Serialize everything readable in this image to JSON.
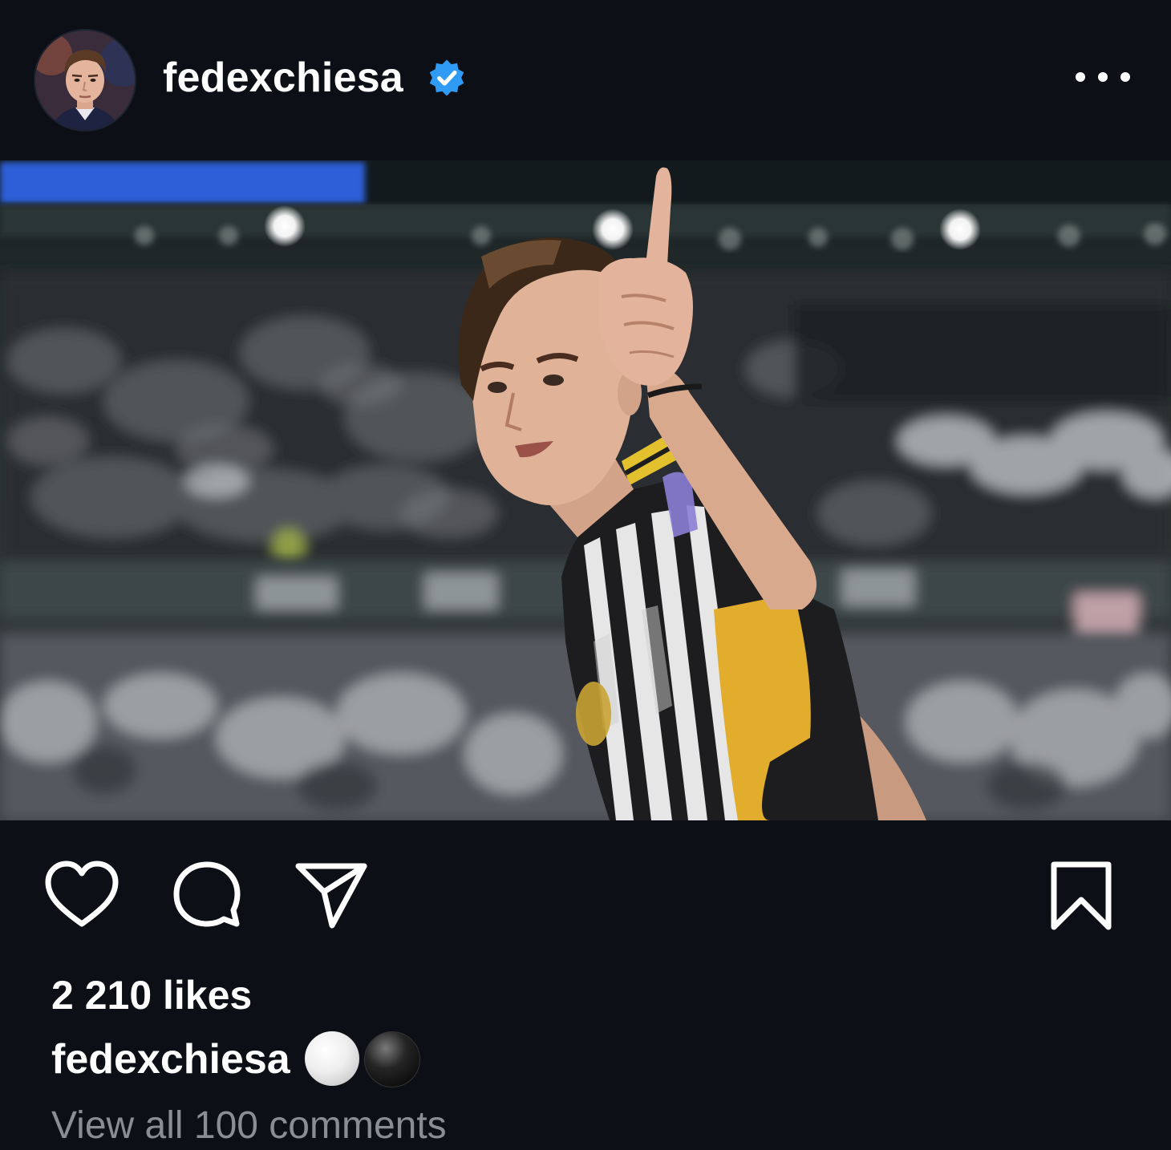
{
  "post": {
    "username": "fedexchiesa",
    "verified": true,
    "likes_text": "2 210 likes",
    "caption": {
      "username": "fedexchiesa",
      "text": "⚪⚫"
    },
    "view_comments_text": "View all 100 comments"
  },
  "icons": {
    "verified": "verified-badge-icon",
    "more": "more-options-icon",
    "like": "heart-icon",
    "comment": "comment-bubble-icon",
    "share": "paper-plane-icon",
    "save": "bookmark-icon"
  },
  "colors": {
    "background": "#0c1016",
    "verified_blue": "#2f9bf5",
    "text_primary": "#ffffff",
    "text_secondary": "#8a8d93"
  }
}
